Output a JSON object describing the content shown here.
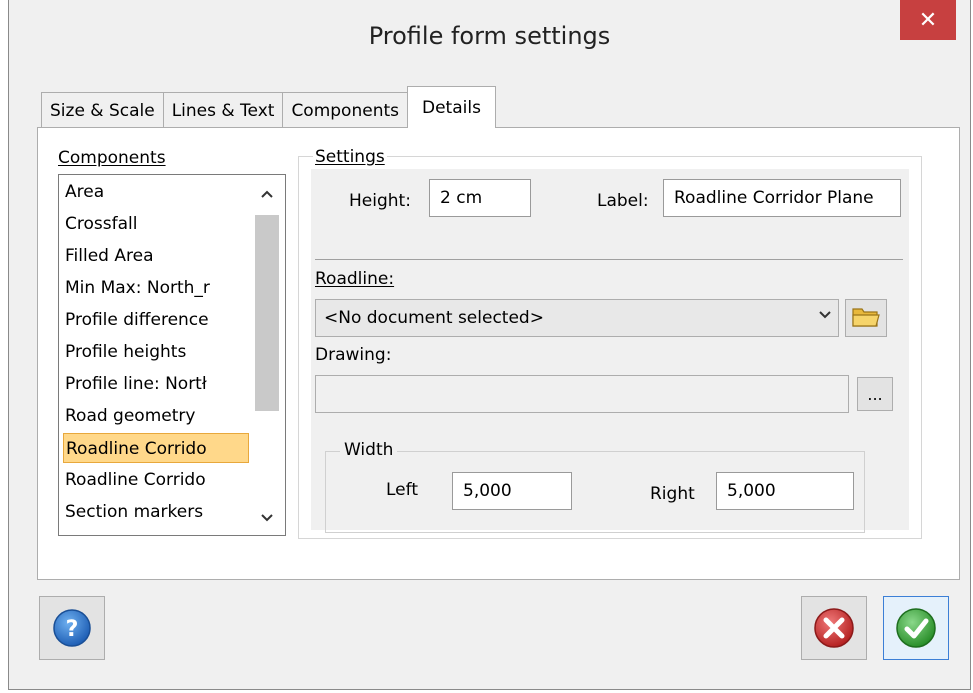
{
  "window": {
    "title": "Profile form settings",
    "close_glyph": "✕"
  },
  "tabs": [
    {
      "label": "Size & Scale"
    },
    {
      "label": "Lines & Text"
    },
    {
      "label": "Components"
    },
    {
      "label": "Details",
      "active": true
    }
  ],
  "components": {
    "title": "Components",
    "items": [
      "Area",
      "Crossfall",
      "Filled Area",
      "Min Max: North_r",
      "Profile difference",
      "Profile heights",
      "Profile line: Nortł",
      "Road geometry",
      "Roadline Corrido",
      "Roadline Corrido",
      "Section markers"
    ],
    "selected_index": 8
  },
  "settings": {
    "title": "Settings",
    "height_label": "Height:",
    "height_value": "2 cm",
    "label_label": "Label:",
    "label_value": "Roadline Corridor Plane",
    "roadline_label": "Roadline:",
    "roadline_value": "<No document selected>",
    "drawing_label": "Drawing:",
    "drawing_value": "",
    "browse_label": "...",
    "width": {
      "title": "Width",
      "left_label": "Left",
      "left_value": "5,000",
      "right_label": "Right",
      "right_value": "5,000"
    }
  },
  "buttons": {
    "help_glyph": "?",
    "cancel_icon": "cancel-icon",
    "ok_icon": "ok-icon"
  },
  "colors": {
    "close": "#c74040",
    "selected_item": "#ffd88a",
    "help_blue": "#2a6ec6",
    "cancel_red": "#d13c3c",
    "ok_green": "#3aa83a"
  }
}
